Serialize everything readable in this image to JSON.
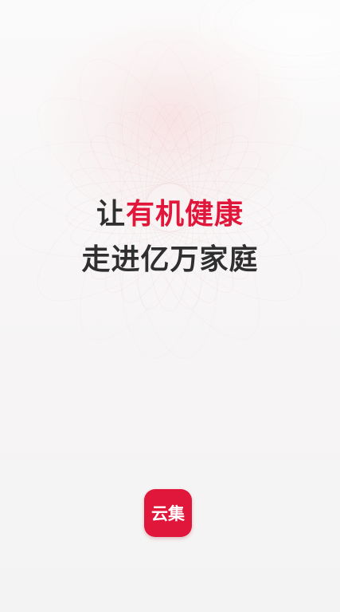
{
  "splash": {
    "headline": {
      "line1_prefix": "让",
      "line1_highlight": "有机健康",
      "line2": "走进亿万家庭"
    },
    "logo_text": "云集"
  },
  "colors": {
    "accent": "#e0173a",
    "headline_text": "#2f2f2f",
    "background": "#f7f6f6"
  }
}
